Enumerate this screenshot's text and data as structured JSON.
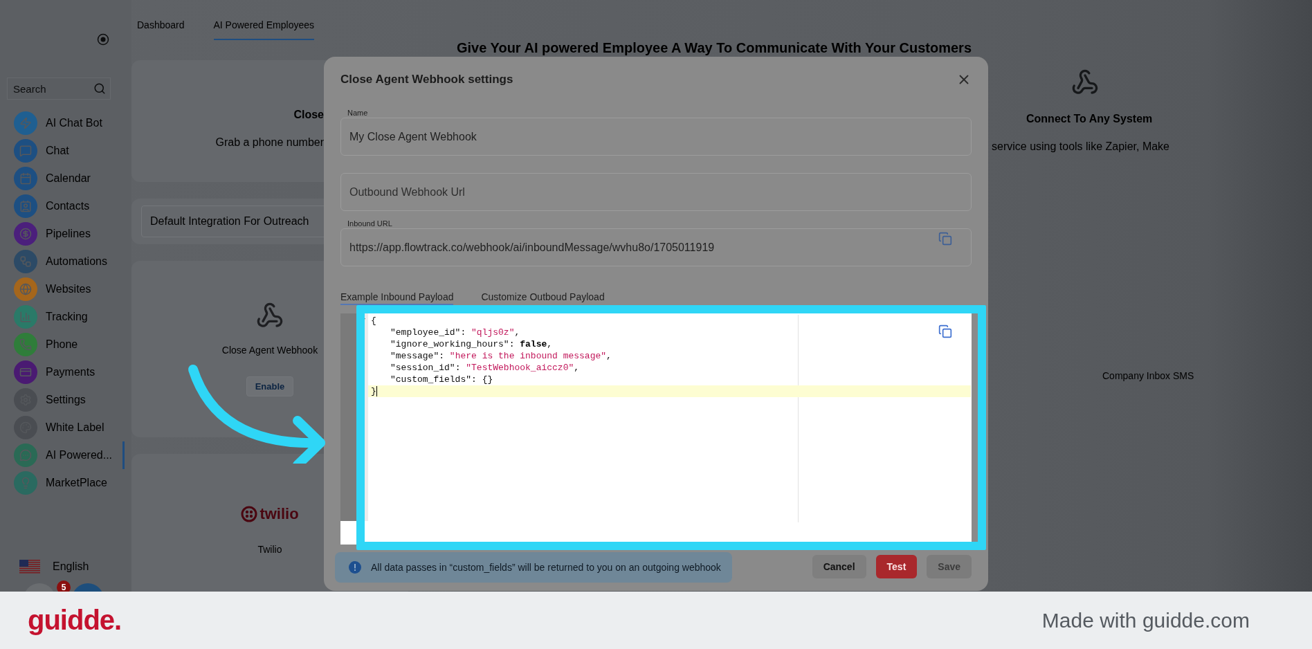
{
  "sidebar": {
    "search": {
      "placeholder": "Search"
    },
    "items": [
      {
        "label": "AI Chat Bot",
        "color": "#1f5f91",
        "selected": false
      },
      {
        "label": "Chat",
        "color": "#1d4f82",
        "selected": false
      },
      {
        "label": "Calendar",
        "color": "#1d4f82",
        "selected": false
      },
      {
        "label": "Contacts",
        "color": "#1d4f82",
        "selected": false
      },
      {
        "label": "Pipelines",
        "color": "#4b1f7c",
        "selected": false
      },
      {
        "label": "Automations",
        "color": "#2c4a66",
        "selected": false
      },
      {
        "label": "Websites",
        "color": "#a5661c",
        "selected": false
      },
      {
        "label": "Tracking",
        "color": "#2a7a68",
        "selected": false
      },
      {
        "label": "Phone",
        "color": "#2f7d3a",
        "selected": false
      },
      {
        "label": "Payments",
        "color": "#4a1a72",
        "selected": false
      },
      {
        "label": "Settings",
        "color": "#4a4d52",
        "selected": false
      },
      {
        "label": "White Label",
        "color": "#4a4d52",
        "selected": false
      },
      {
        "label": "AI Powered...",
        "color": "#2a6a55",
        "selected": true
      },
      {
        "label": "MarketPlace",
        "color": "#2a6a60",
        "selected": false
      }
    ],
    "language": "English",
    "notification_badge": "5"
  },
  "top_tabs": [
    {
      "label": "Dashboard",
      "selected": false
    },
    {
      "label": "AI Powered Employees",
      "selected": true
    }
  ],
  "page_title": "Give Your AI powered Employee A Way To Communicate With Your Customers",
  "channel_cards": [
    {
      "title": "Close",
      "description": "Grab a phone number"
    },
    {
      "title": "Connect To Any System",
      "description": "service using tools like Zapier, Make"
    }
  ],
  "default_integration": {
    "placeholder": "Default Integration For Outreach"
  },
  "left_integrations": [
    {
      "kind": "webhook",
      "title": "Close Agent Webhook",
      "button": "Enable"
    },
    {
      "kind": "twilio",
      "logo_text": "twilio",
      "title": "Twilio"
    }
  ],
  "right_integrations": [
    {
      "title": "Company Inbox SMS"
    }
  ],
  "modal": {
    "title": "Close Agent Webhook settings",
    "name_field": {
      "label": "Name",
      "value": "My Close Agent Webhook"
    },
    "outbound_field": {
      "placeholder": "Outbound Webhook Url"
    },
    "inbound_field": {
      "label": "Inbound URL",
      "value": "https://app.flowtrack.co/webhook/ai/inboundMessage/wvhu8o/1705011919"
    },
    "tabs": [
      {
        "label": "Example Inbound Payload",
        "selected": true
      },
      {
        "label": "Customize Outboud Payload",
        "selected": false
      }
    ],
    "code_lines": [
      {
        "indented": false,
        "foldable": true,
        "active": false,
        "tokens": [
          {
            "kind": "punct",
            "text": "{"
          }
        ]
      },
      {
        "indented": true,
        "foldable": false,
        "active": false,
        "tokens": [
          {
            "kind": "key",
            "text": "\"employee_id\""
          },
          {
            "kind": "punct",
            "text": ": "
          },
          {
            "kind": "string",
            "text": "\"qljs0z\""
          },
          {
            "kind": "punct",
            "text": ","
          }
        ]
      },
      {
        "indented": true,
        "foldable": false,
        "active": false,
        "tokens": [
          {
            "kind": "key",
            "text": "\"ignore_working_hours\""
          },
          {
            "kind": "punct",
            "text": ": "
          },
          {
            "kind": "literal",
            "text": "false"
          },
          {
            "kind": "punct",
            "text": ","
          }
        ]
      },
      {
        "indented": true,
        "foldable": false,
        "active": false,
        "tokens": [
          {
            "kind": "key",
            "text": "\"message\""
          },
          {
            "kind": "punct",
            "text": ": "
          },
          {
            "kind": "string",
            "text": "\"here is the inbound message\""
          },
          {
            "kind": "punct",
            "text": ","
          }
        ]
      },
      {
        "indented": true,
        "foldable": false,
        "active": false,
        "tokens": [
          {
            "kind": "key",
            "text": "\"session_id\""
          },
          {
            "kind": "punct",
            "text": ": "
          },
          {
            "kind": "string",
            "text": "\"TestWebhook_aiccz0\""
          },
          {
            "kind": "punct",
            "text": ","
          }
        ]
      },
      {
        "indented": true,
        "foldable": false,
        "active": false,
        "tokens": [
          {
            "kind": "key",
            "text": "\"custom_fields\""
          },
          {
            "kind": "punct",
            "text": ": {}"
          }
        ]
      },
      {
        "indented": false,
        "foldable": false,
        "active": true,
        "tokens": [
          {
            "kind": "punct",
            "text": "}"
          }
        ]
      }
    ],
    "info": "All data passes in “custom_fields” will be returned to you on an outgoing webhook",
    "buttons": [
      {
        "label": "Cancel",
        "kind": "secondary",
        "disabled": false
      },
      {
        "label": "Test",
        "kind": "danger",
        "disabled": false
      },
      {
        "label": "Save",
        "kind": "primary",
        "disabled": true
      }
    ]
  },
  "footer": {
    "brand": "guidde.",
    "tagline": "Made with guidde.com"
  }
}
